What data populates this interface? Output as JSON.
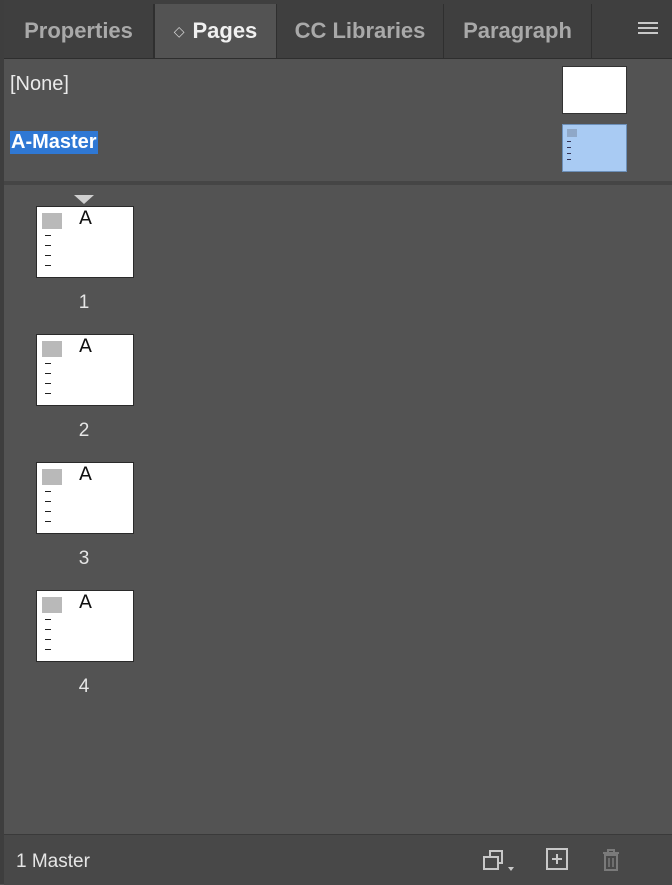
{
  "tabs": [
    {
      "label": "Properties",
      "active": false
    },
    {
      "label": "Pages",
      "active": true
    },
    {
      "label": "CC Libraries",
      "active": false
    },
    {
      "label": "Paragraph",
      "active": false
    }
  ],
  "masters": [
    {
      "label": "[None]",
      "selected": false
    },
    {
      "label": "A-Master",
      "selected": true
    }
  ],
  "pages": [
    {
      "number": "1",
      "master_prefix": "A"
    },
    {
      "number": "2",
      "master_prefix": "A"
    },
    {
      "number": "3",
      "master_prefix": "A"
    },
    {
      "number": "4",
      "master_prefix": "A"
    }
  ],
  "footer": {
    "status": "1 Master"
  },
  "icons": {
    "panel_menu": "hamburger-menu-icon",
    "edit_page_size": "edit-page-size-icon",
    "new_page": "new-page-icon",
    "delete": "trash-icon"
  },
  "colors": {
    "panel_bg": "#535353",
    "selection": "#2f78d4",
    "master_thumb_selected": "#a9cbf3"
  }
}
